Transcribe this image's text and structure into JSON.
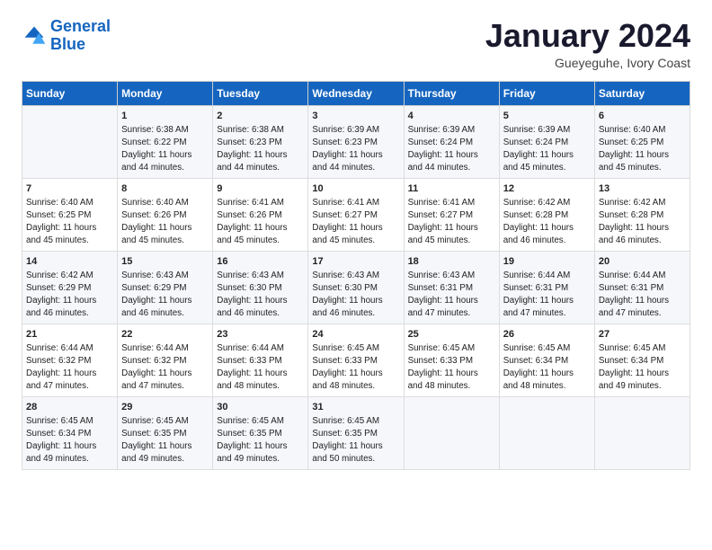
{
  "header": {
    "logo_line1": "General",
    "logo_line2": "Blue",
    "month_title": "January 2024",
    "subtitle": "Gueyeguhe, Ivory Coast"
  },
  "weekdays": [
    "Sunday",
    "Monday",
    "Tuesday",
    "Wednesday",
    "Thursday",
    "Friday",
    "Saturday"
  ],
  "weeks": [
    [
      {
        "day": "",
        "content": ""
      },
      {
        "day": "1",
        "content": "Sunrise: 6:38 AM\nSunset: 6:22 PM\nDaylight: 11 hours\nand 44 minutes."
      },
      {
        "day": "2",
        "content": "Sunrise: 6:38 AM\nSunset: 6:23 PM\nDaylight: 11 hours\nand 44 minutes."
      },
      {
        "day": "3",
        "content": "Sunrise: 6:39 AM\nSunset: 6:23 PM\nDaylight: 11 hours\nand 44 minutes."
      },
      {
        "day": "4",
        "content": "Sunrise: 6:39 AM\nSunset: 6:24 PM\nDaylight: 11 hours\nand 44 minutes."
      },
      {
        "day": "5",
        "content": "Sunrise: 6:39 AM\nSunset: 6:24 PM\nDaylight: 11 hours\nand 45 minutes."
      },
      {
        "day": "6",
        "content": "Sunrise: 6:40 AM\nSunset: 6:25 PM\nDaylight: 11 hours\nand 45 minutes."
      }
    ],
    [
      {
        "day": "7",
        "content": "Sunrise: 6:40 AM\nSunset: 6:25 PM\nDaylight: 11 hours\nand 45 minutes."
      },
      {
        "day": "8",
        "content": "Sunrise: 6:40 AM\nSunset: 6:26 PM\nDaylight: 11 hours\nand 45 minutes."
      },
      {
        "day": "9",
        "content": "Sunrise: 6:41 AM\nSunset: 6:26 PM\nDaylight: 11 hours\nand 45 minutes."
      },
      {
        "day": "10",
        "content": "Sunrise: 6:41 AM\nSunset: 6:27 PM\nDaylight: 11 hours\nand 45 minutes."
      },
      {
        "day": "11",
        "content": "Sunrise: 6:41 AM\nSunset: 6:27 PM\nDaylight: 11 hours\nand 45 minutes."
      },
      {
        "day": "12",
        "content": "Sunrise: 6:42 AM\nSunset: 6:28 PM\nDaylight: 11 hours\nand 46 minutes."
      },
      {
        "day": "13",
        "content": "Sunrise: 6:42 AM\nSunset: 6:28 PM\nDaylight: 11 hours\nand 46 minutes."
      }
    ],
    [
      {
        "day": "14",
        "content": "Sunrise: 6:42 AM\nSunset: 6:29 PM\nDaylight: 11 hours\nand 46 minutes."
      },
      {
        "day": "15",
        "content": "Sunrise: 6:43 AM\nSunset: 6:29 PM\nDaylight: 11 hours\nand 46 minutes."
      },
      {
        "day": "16",
        "content": "Sunrise: 6:43 AM\nSunset: 6:30 PM\nDaylight: 11 hours\nand 46 minutes."
      },
      {
        "day": "17",
        "content": "Sunrise: 6:43 AM\nSunset: 6:30 PM\nDaylight: 11 hours\nand 46 minutes."
      },
      {
        "day": "18",
        "content": "Sunrise: 6:43 AM\nSunset: 6:31 PM\nDaylight: 11 hours\nand 47 minutes."
      },
      {
        "day": "19",
        "content": "Sunrise: 6:44 AM\nSunset: 6:31 PM\nDaylight: 11 hours\nand 47 minutes."
      },
      {
        "day": "20",
        "content": "Sunrise: 6:44 AM\nSunset: 6:31 PM\nDaylight: 11 hours\nand 47 minutes."
      }
    ],
    [
      {
        "day": "21",
        "content": "Sunrise: 6:44 AM\nSunset: 6:32 PM\nDaylight: 11 hours\nand 47 minutes."
      },
      {
        "day": "22",
        "content": "Sunrise: 6:44 AM\nSunset: 6:32 PM\nDaylight: 11 hours\nand 47 minutes."
      },
      {
        "day": "23",
        "content": "Sunrise: 6:44 AM\nSunset: 6:33 PM\nDaylight: 11 hours\nand 48 minutes."
      },
      {
        "day": "24",
        "content": "Sunrise: 6:45 AM\nSunset: 6:33 PM\nDaylight: 11 hours\nand 48 minutes."
      },
      {
        "day": "25",
        "content": "Sunrise: 6:45 AM\nSunset: 6:33 PM\nDaylight: 11 hours\nand 48 minutes."
      },
      {
        "day": "26",
        "content": "Sunrise: 6:45 AM\nSunset: 6:34 PM\nDaylight: 11 hours\nand 48 minutes."
      },
      {
        "day": "27",
        "content": "Sunrise: 6:45 AM\nSunset: 6:34 PM\nDaylight: 11 hours\nand 49 minutes."
      }
    ],
    [
      {
        "day": "28",
        "content": "Sunrise: 6:45 AM\nSunset: 6:34 PM\nDaylight: 11 hours\nand 49 minutes."
      },
      {
        "day": "29",
        "content": "Sunrise: 6:45 AM\nSunset: 6:35 PM\nDaylight: 11 hours\nand 49 minutes."
      },
      {
        "day": "30",
        "content": "Sunrise: 6:45 AM\nSunset: 6:35 PM\nDaylight: 11 hours\nand 49 minutes."
      },
      {
        "day": "31",
        "content": "Sunrise: 6:45 AM\nSunset: 6:35 PM\nDaylight: 11 hours\nand 50 minutes."
      },
      {
        "day": "",
        "content": ""
      },
      {
        "day": "",
        "content": ""
      },
      {
        "day": "",
        "content": ""
      }
    ]
  ]
}
